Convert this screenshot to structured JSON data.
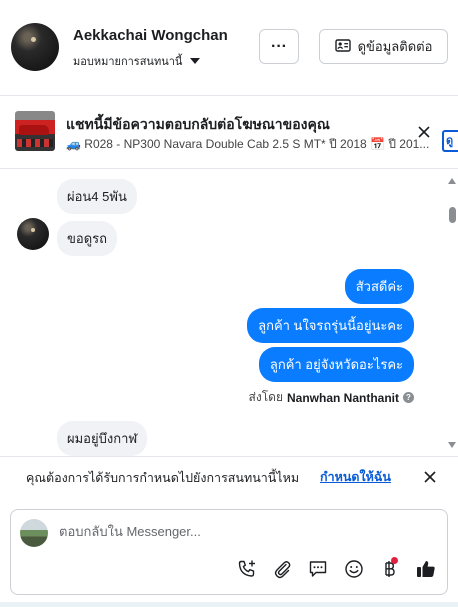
{
  "header": {
    "name": "Aekkachai Wongchan",
    "assign_label": "มอบหมายการสนทนานี้",
    "more_label": "···",
    "contact_label": "ดูข้อมูลติดต่อ"
  },
  "ad": {
    "title": "แชทนี้มีข้อความตอบกลับต่อโฆษณาของคุณ",
    "subtitle": "🚙 R028 - NP300 Navara Double Cab 2.5 S MT* ปี 2018 📅 ปี 201...",
    "clipped_label": "ดู"
  },
  "messages_in": [
    {
      "text": "ผ่อน4 5พัน"
    },
    {
      "text": "ขอดูรถ"
    },
    {
      "text": "ผมอยู่บึงกาฬ"
    }
  ],
  "messages_out": [
    {
      "text": "สัวสดีค่ะ"
    },
    {
      "text": "ลูกค้า นใจรถรุ่นนี้อยู่นะคะ"
    },
    {
      "text": "ลูกค้า  อยู่จังหวัดอะไรคะ"
    }
  ],
  "sent_by": {
    "prefix": "ส่งโดย",
    "name": "Nanwhan Nanthanit"
  },
  "prompt": {
    "text": "คุณต้องการได้รับการกำหนดไปยังการสนทนานี้ไหม",
    "link": "กำหนดให้ฉัน"
  },
  "composer": {
    "placeholder": "ตอบกลับใน Messenger...",
    "tools": [
      "phone-plus-icon",
      "paperclip-icon",
      "saved-reply-icon",
      "emoji-icon",
      "baht-icon",
      "like-icon"
    ]
  },
  "colors": {
    "outgoing_bubble": "#0a7cff",
    "incoming_bubble": "#f0f2f5",
    "link": "#0a5bd7",
    "notification_dot": "#e41e3f"
  }
}
